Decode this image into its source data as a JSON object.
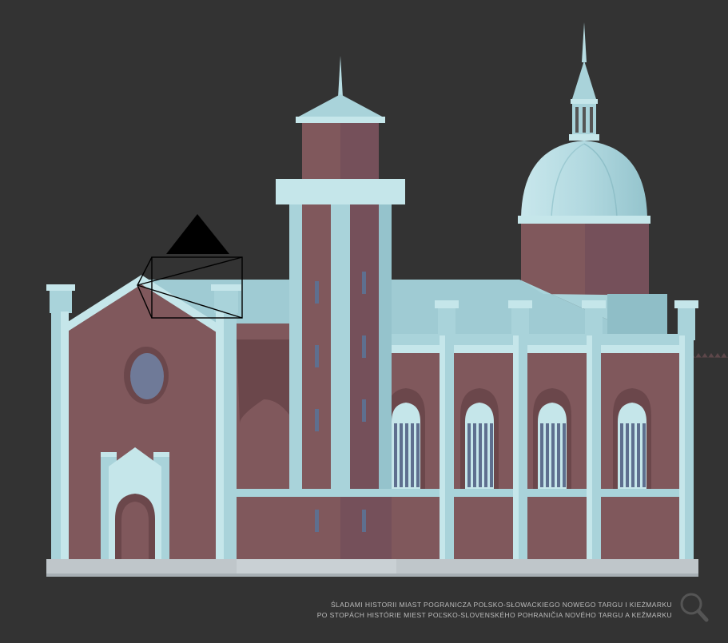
{
  "caption": {
    "line1": "ŚLADAMI HISTORII MIAST POGRANICZA POLSKO-SŁOWACKIEGO NOWEGO TARGU I KIEŻMARKU",
    "line2": "PO STOPÁCH HISTÓRIE MIEST POĽSKO-SLOVENSKÉHO POHRANIČIA NOVÉHO TARGU A KEŽMARKU"
  },
  "icons": {
    "zoom": "magnifier-icon",
    "pointer": "triangle-pointer-icon"
  },
  "colors": {
    "background": "#333333",
    "brick": "#80585c",
    "brick_shadow": "#6b474b",
    "stone": "#a9d3da",
    "stone_light": "#c5e6ea",
    "roof": "#9fcbd3",
    "window": "#5e6f8f",
    "plinth": "#c0c7cb",
    "caption": "#bdbdbd"
  }
}
